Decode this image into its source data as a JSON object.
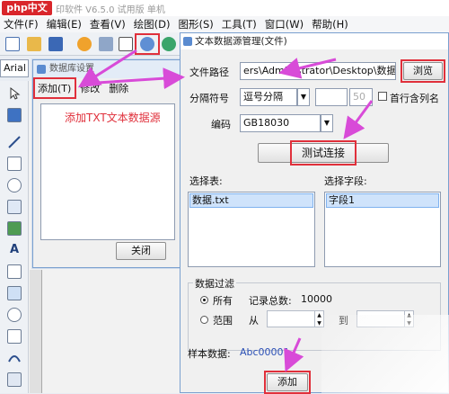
{
  "app": {
    "logo": "php中文网",
    "title": "印软件 V6.5.0 试用版 单机"
  },
  "menu": [
    "文件(F)",
    "编辑(E)",
    "查看(V)",
    "绘图(D)",
    "图形(S)",
    "工具(T)",
    "窗口(W)",
    "帮助(H)"
  ],
  "font_box": "Arial",
  "datasource_dialog": {
    "title": "数据库设置",
    "menu": {
      "add": "添加(T)",
      "edit": "修改",
      "delete": "删除"
    },
    "annotation": "添加TXT文本数据源",
    "close_label": "关闭"
  },
  "text_dialog": {
    "title": "文本数据源管理(文件)",
    "file_path_label": "文件路径",
    "file_path_value": "ers\\Administrator\\Desktop\\数据.txt",
    "browse_label": "浏览",
    "separator_label": "分隔符号",
    "separator_value": "逗号分隔",
    "separator_extra": "",
    "separator_number": "50",
    "first_row_label": "首行含列名",
    "encoding_label": "编码",
    "encoding_value": "GB18030",
    "test_label": "测试连接",
    "select_table_label": "选择表:",
    "table_item": "数据.txt",
    "select_field_label": "选择字段:",
    "field_item": "字段1",
    "filter_title": "数据过滤",
    "all_label": "所有",
    "total_label": "记录总数:",
    "total_value": "10000",
    "range_label": "范围",
    "from_label": "从",
    "to_label": "到",
    "sample_label": "样本数据:",
    "sample_value": "Abc00001",
    "add_label": "添加"
  },
  "colors": {
    "accent_red": "#e0303b",
    "arrow": "#d84bd8",
    "selection": "#cfe3fb"
  }
}
